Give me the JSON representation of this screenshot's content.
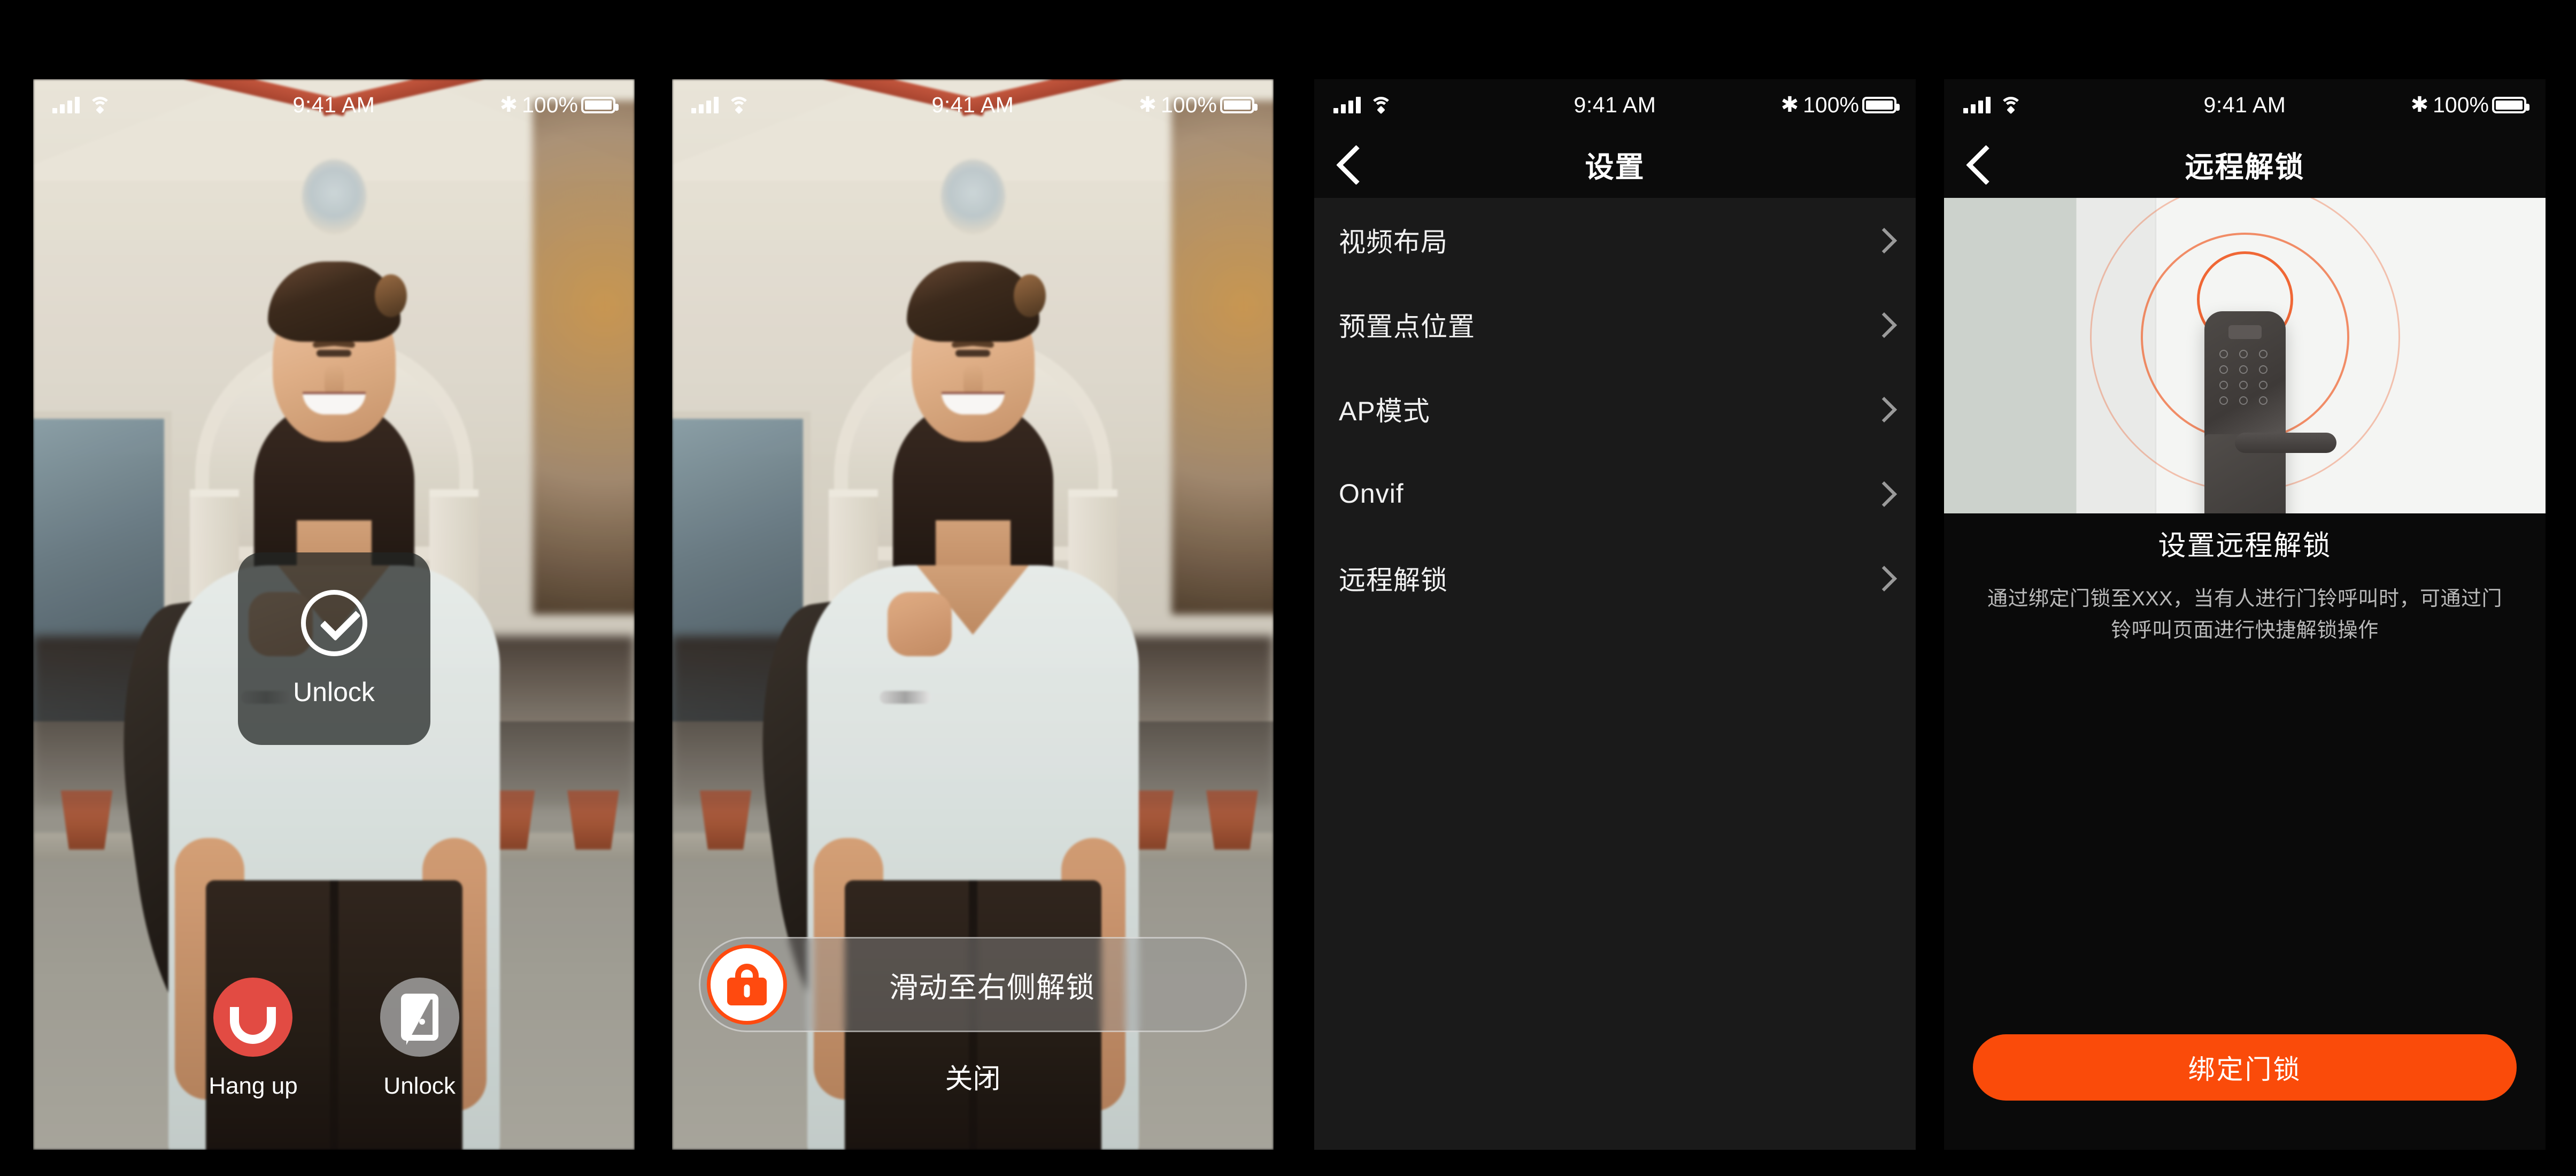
{
  "status_bar": {
    "time": "9:41 AM",
    "battery_text": "100%",
    "bluetooth_glyph": "✱",
    "signal_icon": "cellular-signal-icon",
    "wifi_icon": "wifi-icon",
    "battery_icon": "battery-icon"
  },
  "panel1": {
    "name": "doorbell-call-screen",
    "toast": {
      "label": "Unlock",
      "icon": "check-circle-icon"
    },
    "actions": [
      {
        "label": "Hang up",
        "icon": "phone-hangup-icon",
        "color": "#e24b43"
      },
      {
        "label": "Unlock",
        "icon": "door-open-icon",
        "color": "#a8a8a8"
      }
    ]
  },
  "panel2": {
    "name": "slide-to-unlock-screen",
    "slider": {
      "label": "滑动至右侧解锁",
      "knob_icon": "padlock-icon",
      "knob_color": "#ff4a0f"
    },
    "close_label": "关闭"
  },
  "panel3": {
    "name": "settings-screen",
    "nav": {
      "title": "设置",
      "back_icon": "chevron-left-icon"
    },
    "items": [
      {
        "label": "视频布局"
      },
      {
        "label": "预置点位置"
      },
      {
        "label": "AP模式"
      },
      {
        "label": "Onvif"
      },
      {
        "label": "远程解锁"
      }
    ]
  },
  "panel4": {
    "name": "remote-unlock-setup-screen",
    "nav": {
      "title": "远程解锁",
      "back_icon": "chevron-left-icon"
    },
    "hero": {
      "icon": "smart-door-lock-illustration",
      "ring_color": "#ef5f2a"
    },
    "info_title": "设置远程解锁",
    "info_desc": "通过绑定门锁至XXX，当有人进行门铃呼叫时，可通过门铃呼叫页面进行快捷解锁操作",
    "primary_button": "绑定门锁",
    "primary_button_color": "#fa4b0a"
  }
}
